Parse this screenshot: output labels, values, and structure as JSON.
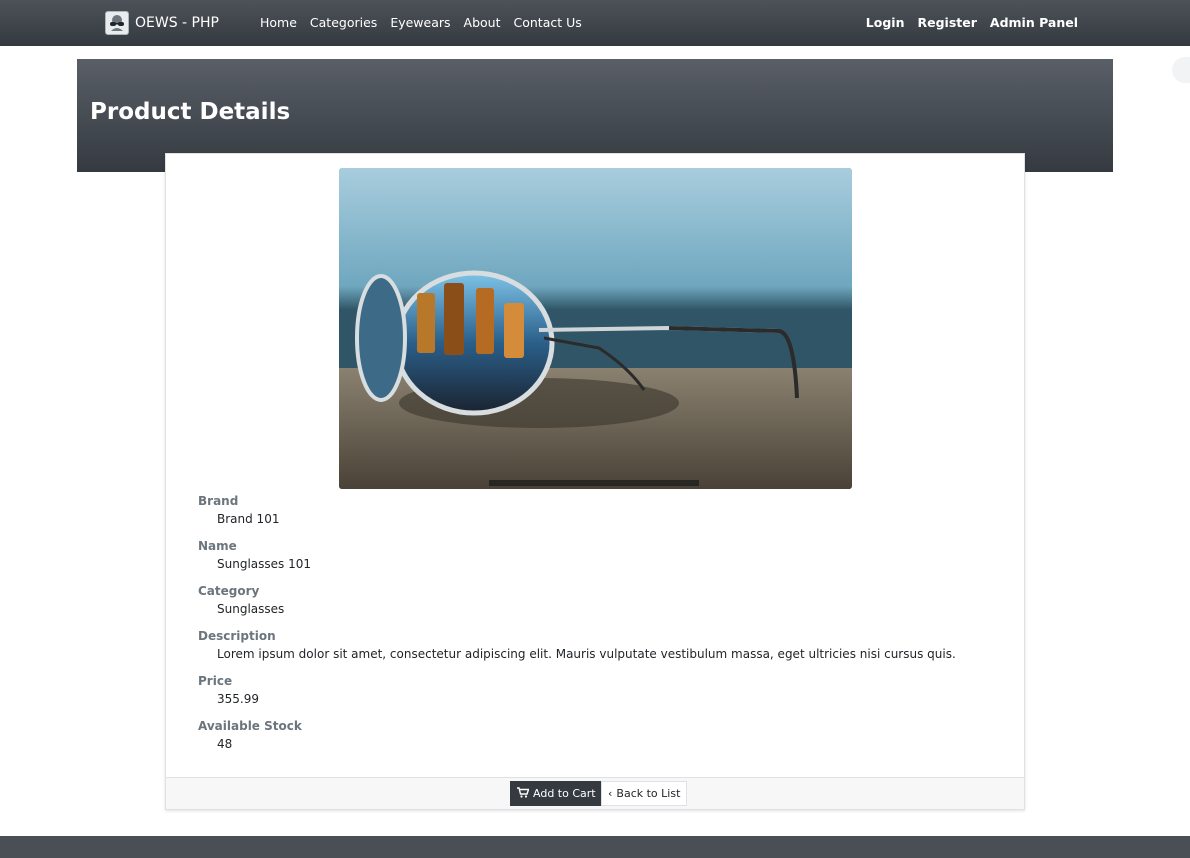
{
  "nav": {
    "brand": "OEWS - PHP",
    "brand_logo_icon": "sunglasses-icon",
    "links": [
      "Home",
      "Categories",
      "Eyewears",
      "About",
      "Contact Us"
    ],
    "right_links": [
      "Login",
      "Register",
      "Admin Panel"
    ]
  },
  "page": {
    "title": "Product Details"
  },
  "product": {
    "fields": [
      {
        "label": "Brand",
        "value": "Brand 101"
      },
      {
        "label": "Name",
        "value": "Sunglasses 101"
      },
      {
        "label": "Category",
        "value": "Sunglasses"
      },
      {
        "label": "Description",
        "value": "Lorem ipsum dolor sit amet, consectetur adipiscing elit. Mauris vulputate vestibulum massa, eget ultricies nisi cursus quis."
      },
      {
        "label": "Price",
        "value": "355.99"
      },
      {
        "label": "Available Stock",
        "value": "48"
      }
    ]
  },
  "actions": {
    "add_to_cart": "Add to Cart",
    "add_to_cart_icon": "cart-icon",
    "back_to_list": "Back to List",
    "back_icon": "chevron-left-icon"
  },
  "colors": {
    "navbar": "#343a40",
    "header": "#4d5259",
    "button_dark": "#343a40"
  }
}
